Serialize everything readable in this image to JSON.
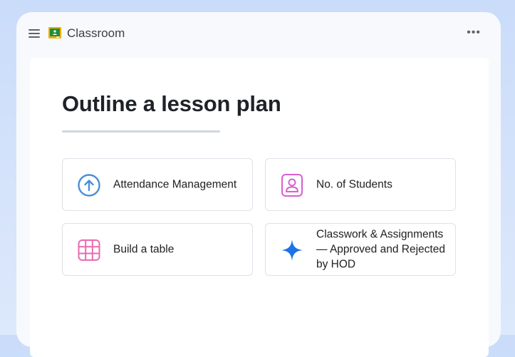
{
  "app": {
    "title": "Classroom"
  },
  "main": {
    "heading": "Outline a lesson plan",
    "cards": [
      {
        "label": "Attendance Management",
        "icon": "arrow-up-circle-icon",
        "color": "#4a8fdc"
      },
      {
        "label": "No. of Students",
        "icon": "person-icon",
        "color": "#d95fd0"
      },
      {
        "label": "Build a table",
        "icon": "table-icon",
        "color": "#e96bb0"
      },
      {
        "label": "Classwork & Assignments — Approved and Rejected by HOD",
        "icon": "sparkle-icon",
        "color": "#1a73e8"
      }
    ]
  },
  "colors": {
    "background": "#d3e2fb",
    "heading": "#1f2328",
    "accent": "#1a73e8"
  }
}
